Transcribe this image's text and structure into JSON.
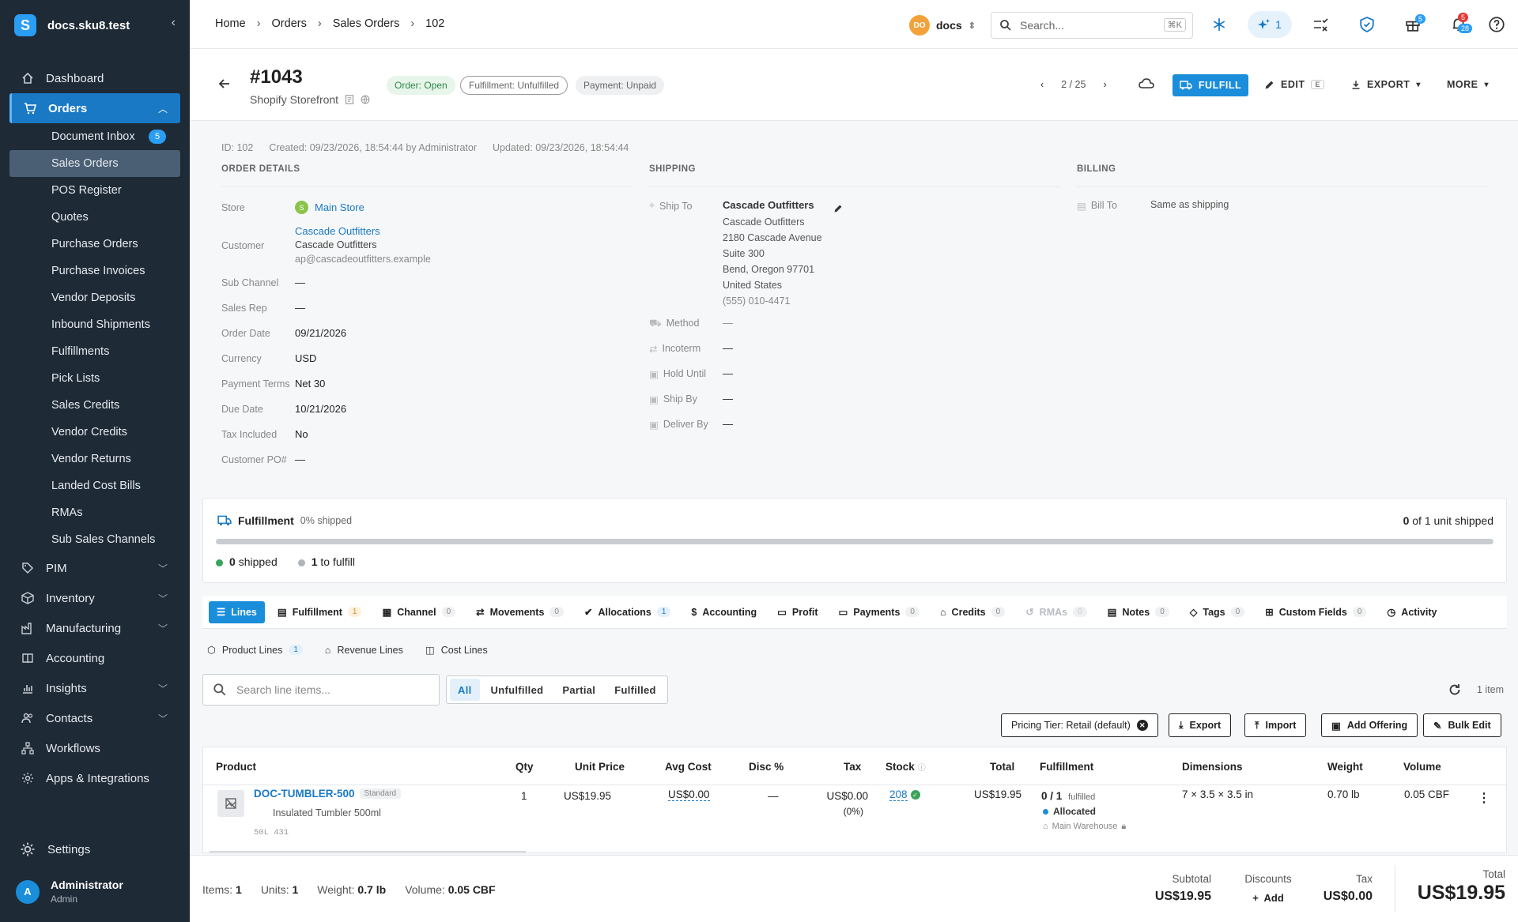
{
  "sidebar": {
    "brand_letter": "S",
    "brand_name": "docs.sku8.test",
    "collapse_icon": "chevron-left-icon",
    "items_top": [
      {
        "label": "Dashboard",
        "icon": "home-icon"
      },
      {
        "label": "Orders",
        "icon": "cart-icon"
      }
    ],
    "orders_sub": [
      {
        "label": "Document Inbox",
        "badge": "5"
      },
      {
        "label": "Sales Orders"
      },
      {
        "label": "POS Register"
      },
      {
        "label": "Quotes"
      },
      {
        "label": "Purchase Orders"
      },
      {
        "label": "Purchase Invoices"
      },
      {
        "label": "Vendor Deposits"
      },
      {
        "label": "Inbound Shipments"
      },
      {
        "label": "Fulfillments"
      },
      {
        "label": "Pick Lists"
      },
      {
        "label": "Sales Credits"
      },
      {
        "label": "Vendor Credits"
      },
      {
        "label": "Vendor Returns"
      },
      {
        "label": "Landed Cost Bills"
      },
      {
        "label": "RMAs"
      },
      {
        "label": "Sub Sales Channels"
      }
    ],
    "items_bottom": [
      {
        "label": "PIM",
        "icon": "tag-icon"
      },
      {
        "label": "Inventory",
        "icon": "box-icon"
      },
      {
        "label": "Manufacturing",
        "icon": "factory-icon"
      },
      {
        "label": "Accounting",
        "icon": "book-icon"
      },
      {
        "label": "Insights",
        "icon": "chart-icon"
      },
      {
        "label": "Contacts",
        "icon": "people-icon"
      },
      {
        "label": "Workflows",
        "icon": "workflow-icon"
      },
      {
        "label": "Apps & Integrations",
        "icon": "gear-cog-icon"
      }
    ],
    "settings": "Settings",
    "user_initial": "A",
    "user_name": "Administrator",
    "user_role": "Admin"
  },
  "topbar": {
    "breadcrumbs": [
      "Home",
      "Orders",
      "Sales Orders",
      "102"
    ],
    "org_initials": "DO",
    "org_name": "docs",
    "search_placeholder": "Search...",
    "search_shortcut": "⌘K",
    "ai_count": "1",
    "gift_badge": "5",
    "notif_badge_top": "5",
    "notif_badge_bottom": "28"
  },
  "header": {
    "order_number": "#1043",
    "source": "Shopify Storefront",
    "status_order": "Order: Open",
    "status_fulfillment": "Fulfillment: Unfulfilled",
    "status_payment": "Payment: Unpaid",
    "pager": "2 / 25",
    "fulfill": "FULFILL",
    "edit": "EDIT",
    "edit_shortcut": "E",
    "export": "EXPORT",
    "more": "MORE"
  },
  "meta": {
    "id": "ID: 102",
    "created": "Created: 09/23/2026, 18:54:44 by Administrator",
    "updated": "Updated: 09/23/2026, 18:54:44"
  },
  "order_details": {
    "heading": "ORDER DETAILS",
    "store_label": "Store",
    "store_badge": "S",
    "store_value": "Main Store",
    "customer_label": "Customer",
    "customer_link": "Cascade Outfitters",
    "customer_name": "Cascade Outfitters",
    "customer_email": "ap@cascadeoutfitters.example",
    "sub_channel_label": "Sub Channel",
    "sub_channel_value": "—",
    "sales_rep_label": "Sales Rep",
    "sales_rep_value": "—",
    "order_date_label": "Order Date",
    "order_date_value": "09/21/2026",
    "currency_label": "Currency",
    "currency_value": "USD",
    "payment_terms_label": "Payment Terms",
    "payment_terms_value": "Net 30",
    "due_date_label": "Due Date",
    "due_date_value": "10/21/2026",
    "tax_included_label": "Tax Included",
    "tax_included_value": "No",
    "customer_po_label": "Customer PO#",
    "customer_po_value": "—"
  },
  "shipping": {
    "heading": "SHIPPING",
    "ship_to_label": "Ship To",
    "ship_to_name": "Cascade Outfitters",
    "address": [
      "Cascade Outfitters",
      "2180 Cascade Avenue",
      "Suite 300",
      "Bend, Oregon 97701",
      "United States"
    ],
    "phone": "(555) 010-4471",
    "method_label": "Method",
    "method_value": "—",
    "incoterm_label": "Incoterm",
    "incoterm_value": "—",
    "hold_until_label": "Hold Until",
    "hold_until_value": "—",
    "ship_by_label": "Ship By",
    "ship_by_value": "—",
    "deliver_by_label": "Deliver By",
    "deliver_by_value": "—"
  },
  "billing": {
    "heading": "BILLING",
    "bill_to_label": "Bill To",
    "bill_to_value": "Same as shipping"
  },
  "fulfillment_card": {
    "title": "Fulfillment",
    "subtitle": "0% shipped",
    "shipped_qty": "0",
    "right_text": "of 1 unit shipped",
    "progress": 0,
    "shipped_count": "0",
    "shipped_label": "shipped",
    "to_fulfill_count": "1",
    "to_fulfill_label": "to fulfill",
    "colors": {
      "shipped": "#3aa35a",
      "pending": "#b0b4ba"
    }
  },
  "tabs": [
    {
      "label": "Lines",
      "icon": "list-icon"
    },
    {
      "label": "Fulfillment",
      "icon": "clipboard-icon",
      "count": "1"
    },
    {
      "label": "Channel",
      "icon": "store-icon",
      "count": "0"
    },
    {
      "label": "Movements",
      "icon": "arrows-icon",
      "count": "0"
    },
    {
      "label": "Allocations",
      "icon": "check-circle-icon",
      "count": "1"
    },
    {
      "label": "Accounting",
      "icon": "dollar-icon"
    },
    {
      "label": "Profit",
      "icon": "money-icon"
    },
    {
      "label": "Payments",
      "icon": "card-icon",
      "count": "0"
    },
    {
      "label": "Credits",
      "icon": "bank-icon",
      "count": "0"
    },
    {
      "label": "RMAs",
      "icon": "return-icon",
      "count": "0"
    },
    {
      "label": "Notes",
      "icon": "note-icon",
      "count": "0"
    },
    {
      "label": "Tags",
      "icon": "tag-icon",
      "count": "0"
    },
    {
      "label": "Custom Fields",
      "icon": "fields-icon",
      "count": "0"
    },
    {
      "label": "Activity",
      "icon": "history-icon"
    }
  ],
  "subtabs": [
    {
      "label": "Product Lines",
      "count": "1"
    },
    {
      "label": "Revenue Lines"
    },
    {
      "label": "Cost Lines"
    }
  ],
  "toolbar": {
    "search_placeholder": "Search line items...",
    "filters": [
      "All",
      "Unfulfilled",
      "Partial",
      "Fulfilled"
    ],
    "items_count": "1 item",
    "pricing_tier": "Pricing Tier: Retail (default)",
    "export": "Export",
    "import": "Import",
    "add_offering": "Add Offering",
    "bulk_edit": "Bulk Edit"
  },
  "table": {
    "headers": [
      "Product",
      "Qty",
      "Unit Price",
      "Avg Cost",
      "Disc %",
      "Tax",
      "Stock",
      "Total",
      "Fulfillment",
      "Dimensions",
      "Weight",
      "Volume"
    ],
    "row": {
      "sku": "DOC-TUMBLER-500",
      "type": "Standard",
      "name": "Insulated Tumbler 500ml",
      "code": "50L 431",
      "qty": "1",
      "unit_price": "US$19.95",
      "avg_cost": "US$0.00",
      "disc": "—",
      "tax": "US$0.00",
      "tax_pct": "(0%)",
      "stock": "208",
      "total": "US$19.95",
      "fulfilled": "0 / 1",
      "fulfilled_label": "fulfilled",
      "allocated": "Allocated",
      "warehouse": "Main Warehouse",
      "dimensions": "7 × 3.5 × 3.5 in",
      "weight": "0.70 lb",
      "volume": "0.05 CBF"
    }
  },
  "footer": {
    "items_label": "Items:",
    "items_value": "1",
    "units_label": "Units:",
    "units_value": "1",
    "weight_label": "Weight:",
    "weight_value": "0.7 lb",
    "volume_label": "Volume:",
    "volume_value": "0.05 CBF",
    "subtotal_label": "Subtotal",
    "subtotal_value": "US$19.95",
    "discounts_label": "Discounts",
    "discounts_add": "Add",
    "tax_label": "Tax",
    "tax_value": "US$0.00",
    "total_label": "Total",
    "total_value": "US$19.95"
  }
}
